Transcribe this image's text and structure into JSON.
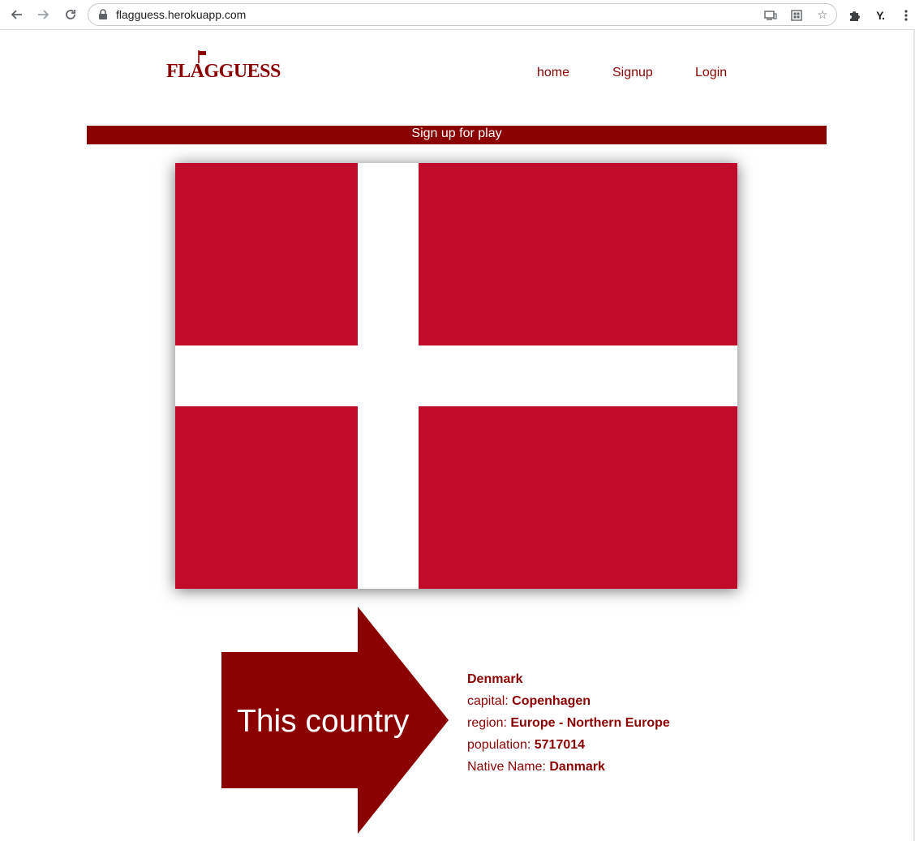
{
  "browser": {
    "url": "flagguess.herokuapp.com",
    "icons": {
      "back": "arrow-left-icon",
      "forward": "arrow-right-icon",
      "reload": "reload-icon",
      "lock": "lock-icon",
      "cast": "cast-icon",
      "qr": "qr-icon",
      "bookmark": "star-icon",
      "extensions": "puzzle-icon",
      "menu": "kebab-menu-icon"
    },
    "extension_label": "Y."
  },
  "header": {
    "logo": "FLAGGUESS",
    "nav": [
      {
        "label": "home"
      },
      {
        "label": "Signup"
      },
      {
        "label": "Login"
      }
    ]
  },
  "banner": {
    "text": "Sign up for play"
  },
  "flag": {
    "field_color": "#c00c2a",
    "cross_color": "#ffffff"
  },
  "arrow": {
    "text": "This country",
    "color": "#8b0000"
  },
  "country": {
    "name": "Denmark",
    "capital_label": "capital:",
    "capital": "Copenhagen",
    "region_label": "region:",
    "region": "Europe - Northern Europe",
    "population_label": "population:",
    "population": "5717014",
    "native_label": "Native Name:",
    "native_name": "Danmark"
  },
  "colors": {
    "accent": "#8b0000"
  }
}
